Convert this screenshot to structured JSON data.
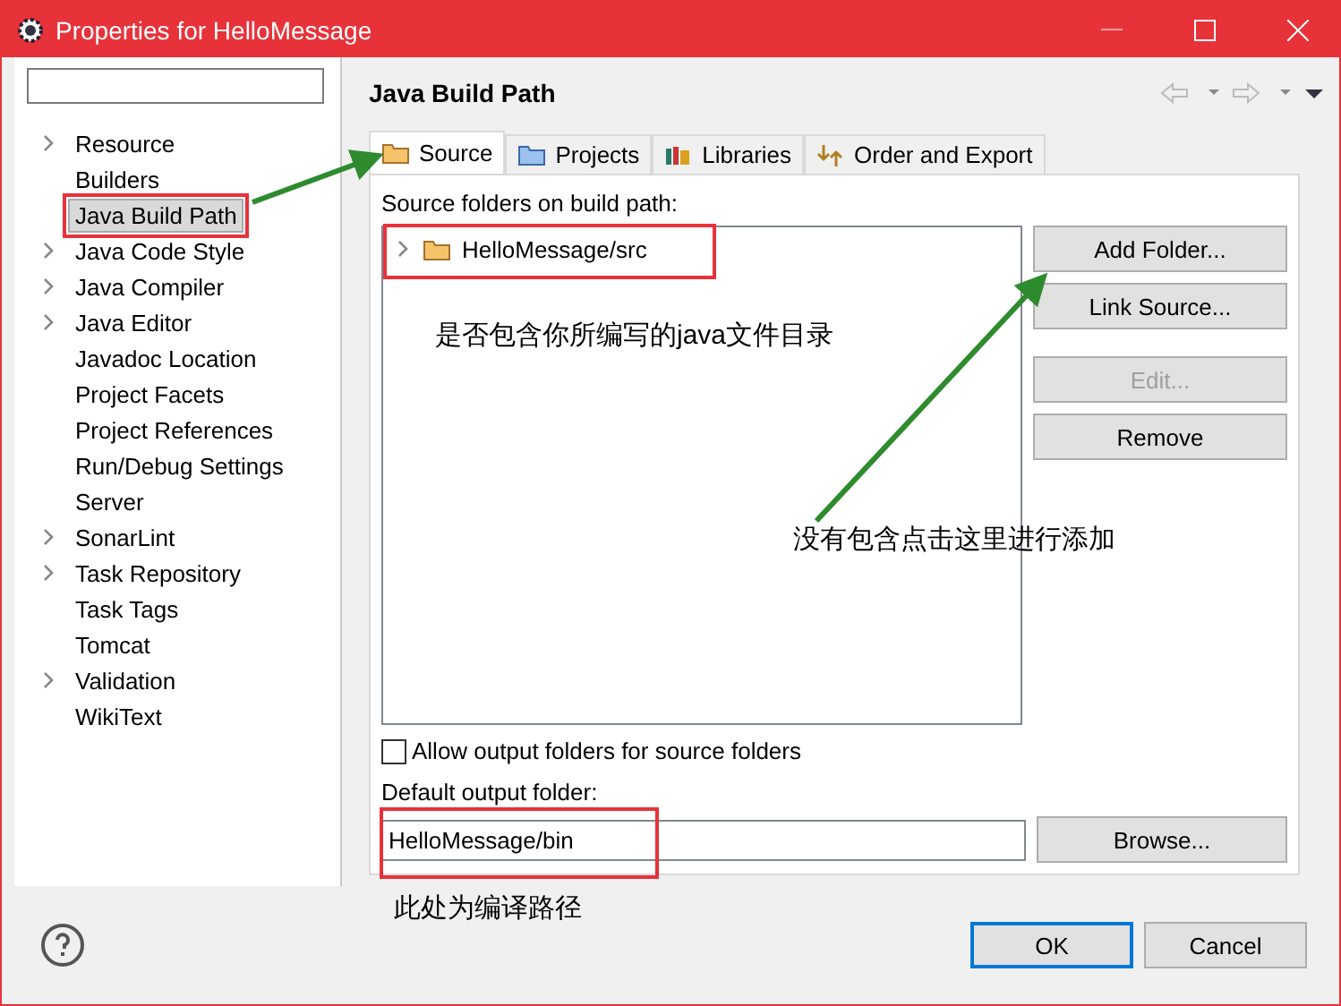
{
  "window": {
    "title": "Properties for HelloMessage"
  },
  "sidebar": {
    "items": [
      {
        "label": "Resource",
        "expandable": true,
        "selected": false
      },
      {
        "label": "Builders",
        "expandable": false,
        "selected": false
      },
      {
        "label": "Java Build Path",
        "expandable": false,
        "selected": true
      },
      {
        "label": "Java Code Style",
        "expandable": true,
        "selected": false
      },
      {
        "label": "Java Compiler",
        "expandable": true,
        "selected": false
      },
      {
        "label": "Java Editor",
        "expandable": true,
        "selected": false
      },
      {
        "label": "Javadoc Location",
        "expandable": false,
        "selected": false
      },
      {
        "label": "Project Facets",
        "expandable": false,
        "selected": false
      },
      {
        "label": "Project References",
        "expandable": false,
        "selected": false
      },
      {
        "label": "Run/Debug Settings",
        "expandable": false,
        "selected": false
      },
      {
        "label": "Server",
        "expandable": false,
        "selected": false
      },
      {
        "label": "SonarLint",
        "expandable": true,
        "selected": false
      },
      {
        "label": "Task Repository",
        "expandable": true,
        "selected": false
      },
      {
        "label": "Task Tags",
        "expandable": false,
        "selected": false
      },
      {
        "label": "Tomcat",
        "expandable": false,
        "selected": false
      },
      {
        "label": "Validation",
        "expandable": true,
        "selected": false
      },
      {
        "label": "WikiText",
        "expandable": false,
        "selected": false
      }
    ]
  },
  "page": {
    "title": "Java Build Path"
  },
  "tabs": [
    {
      "label": "Source",
      "selected": true
    },
    {
      "label": "Projects",
      "selected": false
    },
    {
      "label": "Libraries",
      "selected": false
    },
    {
      "label": "Order and Export",
      "selected": false
    }
  ],
  "source": {
    "label": "Source folders on build path:",
    "folders": [
      {
        "label": "HelloMessage/src",
        "expanded": false
      }
    ],
    "buttons": [
      {
        "label": "Add Folder...",
        "disabled": false
      },
      {
        "label": "Link Source...",
        "disabled": false
      },
      {
        "label": "Edit...",
        "disabled": true
      },
      {
        "label": "Remove",
        "disabled": false
      }
    ]
  },
  "allow_output": {
    "label": "Allow output folders for source folders",
    "checked": false
  },
  "output": {
    "label": "Default output folder:",
    "value": "HelloMessage/bin",
    "button": "Browse..."
  },
  "annotations": [
    "是否包含你所编写的java文件目录",
    "没有包含点击这里进行添加",
    "此处为编译路径"
  ],
  "footer": {
    "buttons": [
      {
        "label": "OK",
        "default": true
      },
      {
        "label": "Cancel",
        "default": false
      }
    ]
  }
}
